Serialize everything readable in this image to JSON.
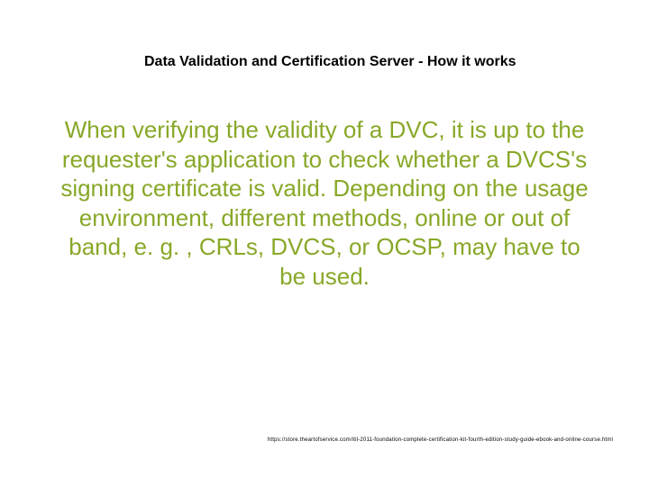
{
  "slide": {
    "title": "Data Validation and Certification Server - How it works",
    "body": "When verifying the validity of a DVC, it is up to the requester's application to check whether a DVCS's signing certificate is valid. Depending on the usage environment, different methods, online or out of band, e. g. , CRLs, DVCS, or OCSP, may have to be used.",
    "footer_url": "https://store.theartofservice.com/itil-2011-foundation-complete-certification-kit-fourth-edition-study-guide-ebook-and-online-course.html"
  }
}
